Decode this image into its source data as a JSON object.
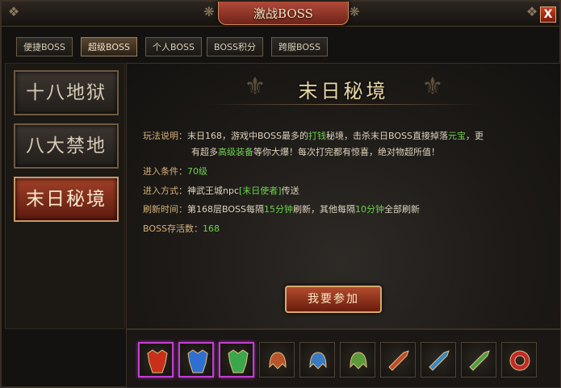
{
  "window": {
    "title": "激战BOSS",
    "close_label": "X"
  },
  "tabs": [
    {
      "label": "便捷BOSS",
      "active": false
    },
    {
      "label": "超级BOSS",
      "active": true
    },
    {
      "label": "个人BOSS",
      "active": false
    },
    {
      "label": "BOSS积分",
      "active": false
    },
    {
      "label": "跨服BOSS",
      "active": false
    }
  ],
  "sidebar": {
    "items": [
      {
        "label": "十八地狱",
        "active": false
      },
      {
        "label": "八大禁地",
        "active": false
      },
      {
        "label": "末日秘境",
        "active": true
      }
    ]
  },
  "main": {
    "title": "末日秘境",
    "desc_label": "玩法说明：",
    "desc_line1": {
      "a": "末日168，游戏中BOSS最多的",
      "b": "打钱",
      "c": "秘境，击杀末日BOSS直接掉落",
      "d": "元宝",
      "e": "，更"
    },
    "desc_line2": {
      "a": "有超多",
      "b": "高级装备",
      "c": "等你大爆！每次打完都有惊喜，绝对物超所值！"
    },
    "condition_label": "进入条件：",
    "condition_value": "70级",
    "method_label": "进入方式：",
    "method_a": "神武王城npc",
    "method_b": "[末日使者]",
    "method_c": "传送",
    "refresh_label": "刷新时间：",
    "refresh": {
      "a": "第168层BOSS每隔",
      "b": "15分钟",
      "c": "刷新，其他每隔",
      "d": "10分钟",
      "e": "全部刷新"
    },
    "alive_label": "BOSS存活数：",
    "alive_value": "168",
    "join_label": "我要参加"
  },
  "rewards": [
    {
      "icon": "red-armor-icon",
      "rarity": "purple",
      "color": "#c8301c"
    },
    {
      "icon": "blue-armor-icon",
      "rarity": "purple",
      "color": "#2f6fd0"
    },
    {
      "icon": "green-armor-icon",
      "rarity": "purple",
      "color": "#3aa84a"
    },
    {
      "icon": "red-helmet-icon",
      "rarity": "normal",
      "color": "#b8542a"
    },
    {
      "icon": "blue-helmet-icon",
      "rarity": "normal",
      "color": "#3a7ac0"
    },
    {
      "icon": "green-helmet-icon",
      "rarity": "normal",
      "color": "#5a9a3a"
    },
    {
      "icon": "red-sword-icon",
      "rarity": "normal",
      "color": "#c04a2a"
    },
    {
      "icon": "blue-sword-icon",
      "rarity": "normal",
      "color": "#3a86c8"
    },
    {
      "icon": "green-sword-icon",
      "rarity": "normal",
      "color": "#4aa04a"
    },
    {
      "icon": "red-bracelet-icon",
      "rarity": "normal",
      "color": "#c02a2a"
    }
  ]
}
